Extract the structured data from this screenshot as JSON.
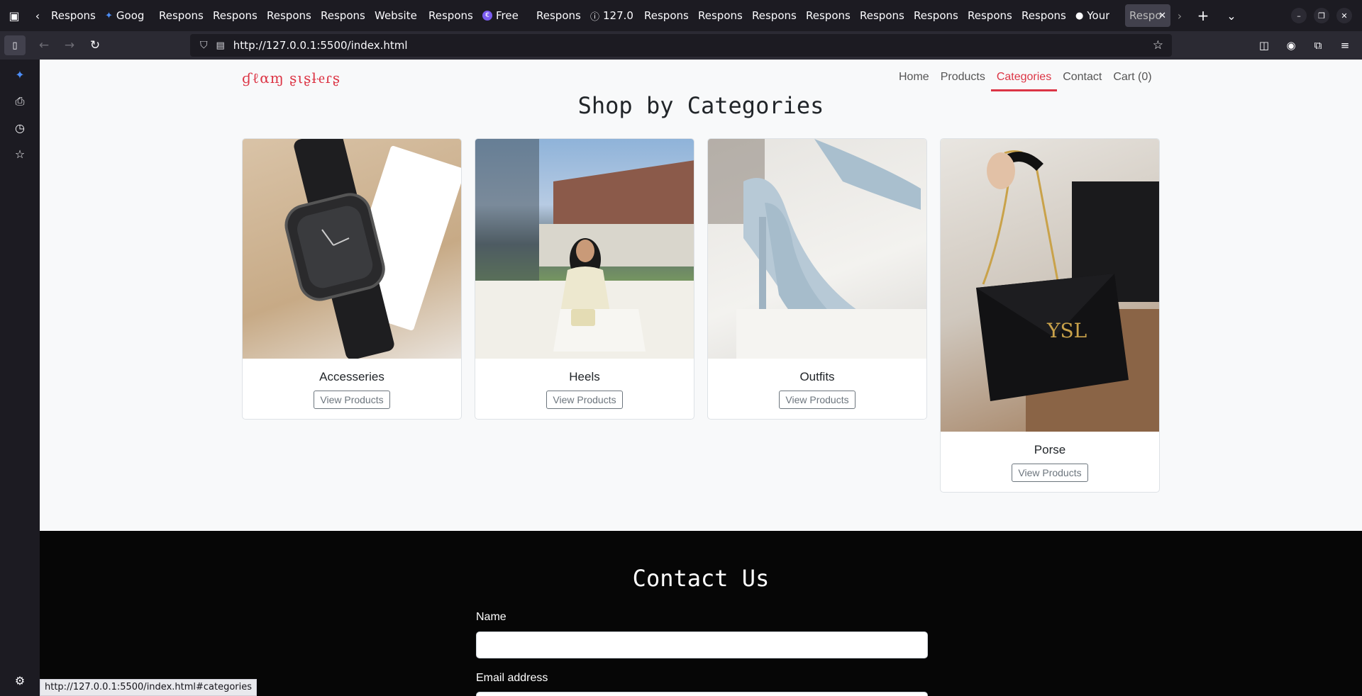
{
  "browser": {
    "tabs": [
      {
        "label": "Respons",
        "icon": "page-icon"
      },
      {
        "label": "Goog",
        "icon": "gemini-icon"
      },
      {
        "label": "Respons",
        "icon": "page-icon"
      },
      {
        "label": "Respons",
        "icon": "page-icon"
      },
      {
        "label": "Respons",
        "icon": "page-icon"
      },
      {
        "label": "Respons",
        "icon": "page-icon"
      },
      {
        "label": "Website",
        "icon": "page-icon"
      },
      {
        "label": "Respons",
        "icon": "page-icon"
      },
      {
        "label": "Free",
        "icon": "free-icon"
      },
      {
        "label": "Respons",
        "icon": "page-icon"
      },
      {
        "label": "127.0",
        "icon": "info-icon"
      },
      {
        "label": "Respons",
        "icon": "page-icon"
      },
      {
        "label": "Respons",
        "icon": "page-icon"
      },
      {
        "label": "Respons",
        "icon": "page-icon"
      },
      {
        "label": "Respons",
        "icon": "page-icon"
      },
      {
        "label": "Respons",
        "icon": "page-icon"
      },
      {
        "label": "Respons",
        "icon": "page-icon"
      },
      {
        "label": "Respons",
        "icon": "page-icon"
      },
      {
        "label": "Respons",
        "icon": "page-icon"
      },
      {
        "label": "Your",
        "icon": "github-icon"
      },
      {
        "label": "Respo",
        "icon": "page-icon",
        "active": true
      }
    ],
    "url": "http://127.0.0.1:5500/index.html",
    "status_url": "http://127.0.0.1:5500/index.html#categories"
  },
  "site": {
    "brand": "ɠℓαɱ ʂιʂƚҽɾʂ",
    "brand_color": "#dc3545",
    "nav": [
      {
        "label": "Home",
        "active": false
      },
      {
        "label": "Products",
        "active": false
      },
      {
        "label": "Categories",
        "active": true
      },
      {
        "label": "Contact",
        "active": false
      },
      {
        "label": "Cart (0)",
        "active": false
      }
    ],
    "categories_title": "Shop by Categories",
    "categories": [
      {
        "name": "Accesseries",
        "button": "View Products",
        "image": "watch"
      },
      {
        "name": "Heels",
        "button": "View Products",
        "image": "woman-with-handbag"
      },
      {
        "name": "Outfits",
        "button": "View Products",
        "image": "light-blue-heels"
      },
      {
        "name": "Porse",
        "button": "View Products",
        "image": "black-chain-bag"
      }
    ],
    "contact": {
      "title": "Contact Us",
      "name_label": "Name",
      "email_label": "Email address"
    }
  }
}
